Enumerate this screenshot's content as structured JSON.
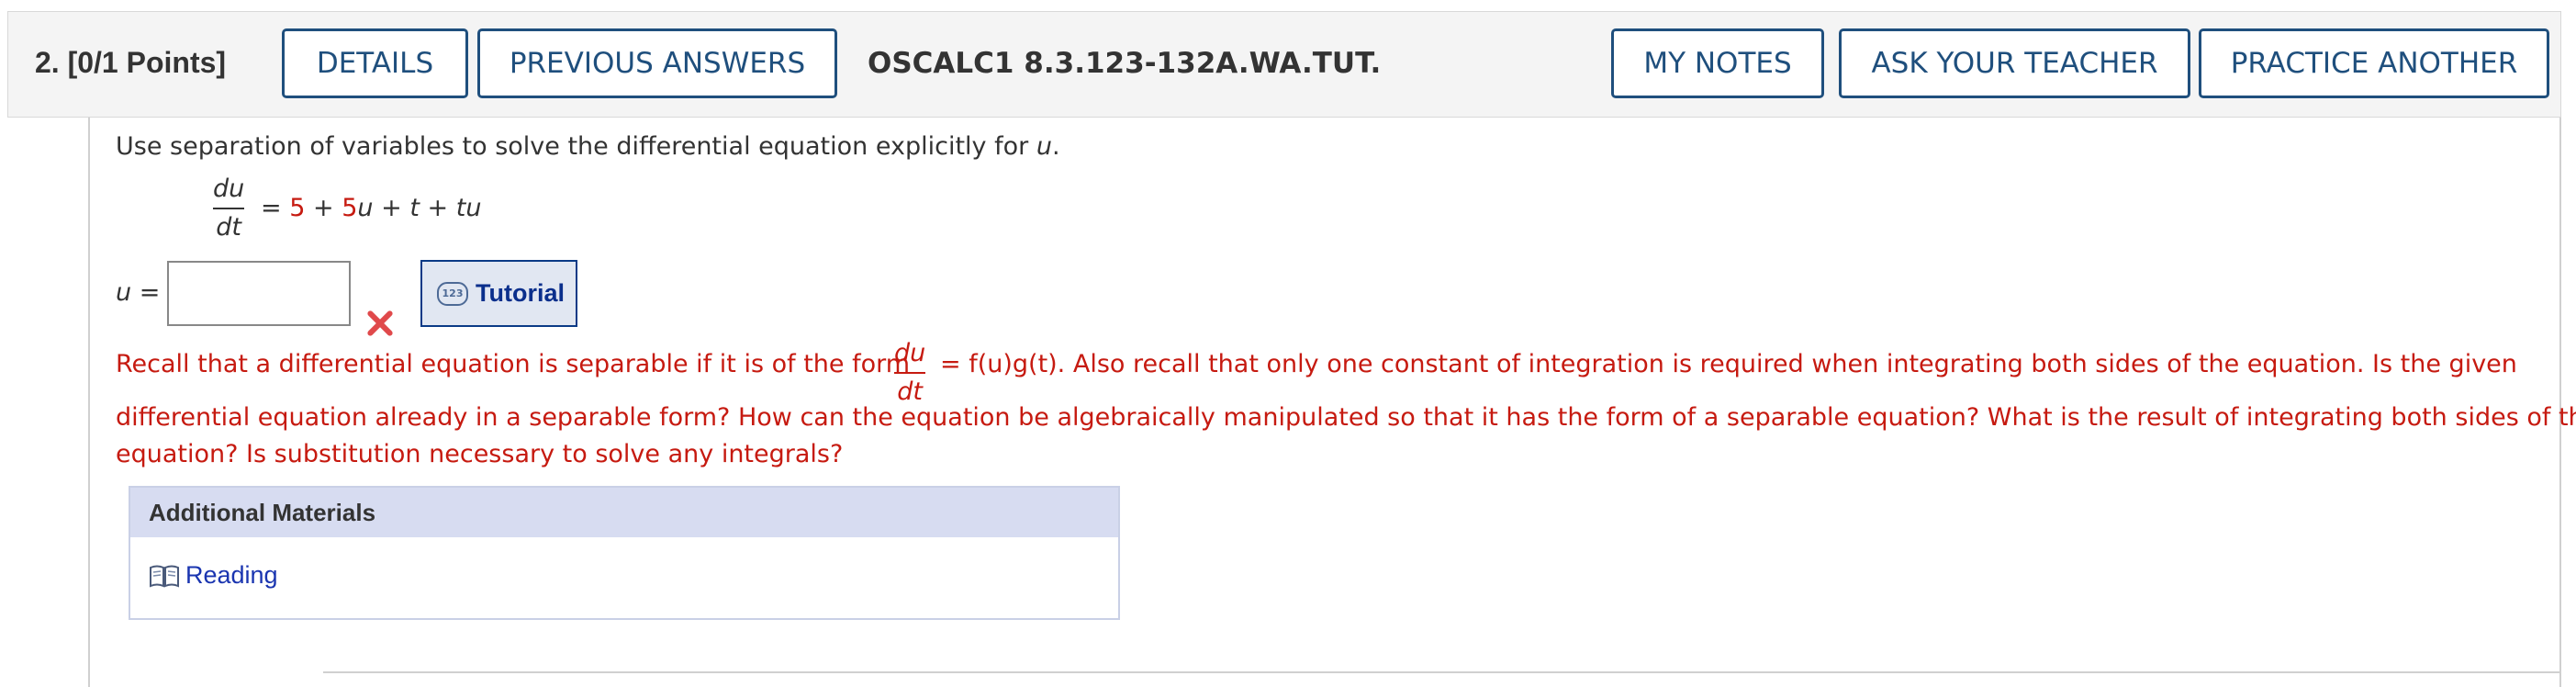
{
  "header": {
    "question_number": "2.",
    "points": "[0/1 Points]",
    "details_label": "DETAILS",
    "previous_answers_label": "PREVIOUS ANSWERS",
    "question_id": "OSCALC1 8.3.123-132A.WA.TUT.",
    "my_notes_label": "MY NOTES",
    "ask_teacher_label": "ASK YOUR TEACHER",
    "practice_another_label": "PRACTICE ANOTHER"
  },
  "question": {
    "prompt": "Use separation of variables to solve the differential equation explicitly for",
    "prompt_var": "u",
    "prompt_end": ".",
    "eq_num": "du",
    "eq_den": "dt",
    "eq_equals": "=",
    "eq_const": "5",
    "eq_plus1": "+",
    "eq_coef": "5",
    "eq_u": "u",
    "eq_plus2": "+",
    "eq_t": "t",
    "eq_plus3": "+",
    "eq_tu": "tu"
  },
  "answer": {
    "label_var": "u",
    "label_equals": "=",
    "value": "",
    "status": "incorrect"
  },
  "tutorial": {
    "icon_text": "123",
    "label": "Tutorial"
  },
  "hint": {
    "part1": "Recall that a differential equation is separable if it is of the form",
    "frac_num": "du",
    "frac_den": "dt",
    "part2": "= f(u)g(t). Also recall that only one constant of integration is required when integrating both sides of the equation. Is the given",
    "line2": "differential equation already in a separable form? How can the equation be algebraically manipulated so that it has the form of a separable equation? What is the result of integrating both sides of the",
    "line3": "equation? Is substitution necessary to solve any integrals?"
  },
  "additional_materials": {
    "title": "Additional Materials",
    "reading_label": "Reading"
  },
  "colors": {
    "accent_navy": "#1f4f7d",
    "hint_red": "#c61a10",
    "panel_blue": "#d7dcf1",
    "link_blue": "#1a35b0"
  }
}
